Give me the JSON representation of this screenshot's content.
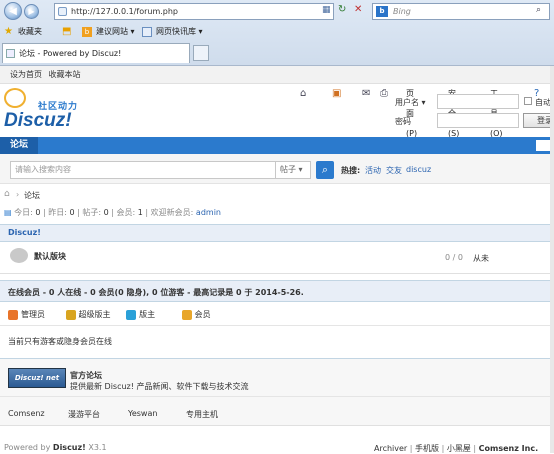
{
  "browser": {
    "url": "http://127.0.0.1/forum.php",
    "search_placeholder": "Bing",
    "favorites_label": "收藏夹",
    "fav_items": [
      "建议网站 ▾",
      "网页快讯库 ▾"
    ],
    "tab_title": "论坛 - Powered by Discuz!",
    "cmd_items": [
      "页面(P) ▾",
      "安全(S) ▾",
      "工具(O) ▾"
    ]
  },
  "topbar": {
    "set_home": "设为首页",
    "bookmark": "收藏本站"
  },
  "header": {
    "logo_sub": "社区动力",
    "logo_main": "Discuz!",
    "username_label": "用户名 ▾",
    "password_label": "密码",
    "auto_login": "自动",
    "login_button": "登录"
  },
  "nav": {
    "current": "论坛"
  },
  "search": {
    "placeholder": "请输入搜索内容",
    "type_select": "帖子 ▾",
    "hot_label": "热搜:",
    "hot_items": [
      "活动",
      "交友",
      "discuz"
    ]
  },
  "breadcrumb": {
    "current": "论坛"
  },
  "stats": {
    "today_label": "今日:",
    "today": "0",
    "yesterday_label": "昨日:",
    "yesterday": "0",
    "posts_label": "帖子:",
    "posts": "0",
    "members_label": "会员:",
    "members": "1",
    "welcome_label": "欢迎新会员:",
    "welcome_user": "admin"
  },
  "category": {
    "name": "Discuz!"
  },
  "forum": {
    "name": "默认版块",
    "counts": "0 / 0",
    "last": "从未"
  },
  "online": {
    "title": "在线会员 - 0 人在线 - 0 会员(0 隐身), 0 位游客 - 最高记录是 0 于 2014-5-26.",
    "legend": [
      "管理员",
      "超级版主",
      "版主",
      "会员"
    ],
    "legend_colors": [
      "#e8742a",
      "#d9a520",
      "#2aa0d8",
      "#e8a62a"
    ],
    "note": "当前只有游客或隐身会员在线"
  },
  "links": {
    "badge": "Discuz! net",
    "title": "官方论坛",
    "desc": "提供最新 Discuz! 产品新闻、软件下载与技术交流",
    "items": [
      "Comsenz",
      "漫游平台",
      "Yeswan",
      "专用主机"
    ]
  },
  "footer": {
    "powered": "Powered by",
    "brand": "Discuz!",
    "version": "X3.1",
    "right_items": [
      "Archiver",
      "手机版",
      "小黑屋",
      "Comsenz Inc."
    ]
  }
}
